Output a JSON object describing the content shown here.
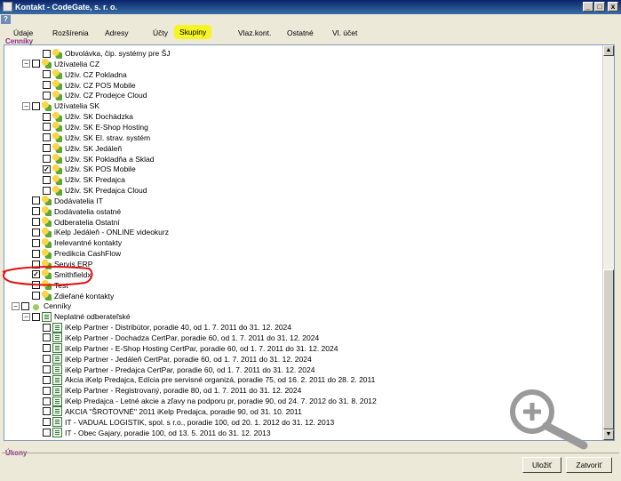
{
  "window": {
    "title": "Kontakt - CodeGate, s. r. o.",
    "help_label": "?",
    "minimize_label": "_",
    "maximize_label": "□",
    "close_label": "x"
  },
  "tabs": [
    {
      "label": "Údaje",
      "active": false
    },
    {
      "label": "Rozšírenia",
      "active": false
    },
    {
      "label": "Adresy",
      "active": false
    },
    {
      "label": "Účty",
      "active": false
    },
    {
      "label": "Skupiny",
      "active": true
    },
    {
      "label": "Vlaz.kont.",
      "active": false
    },
    {
      "label": "Ostatné",
      "active": false
    },
    {
      "label": "Vl. účet",
      "active": false
    }
  ],
  "section_top": "Cenníky",
  "section_bottom": "Úkony",
  "tree": [
    {
      "label": "Obvolávka, čip. systémy pre ŠJ",
      "checked": false,
      "icon": "group-icon"
    },
    {
      "label": "Užívatelia CZ",
      "checked": false,
      "icon": "group-icon"
    },
    {
      "label": "Uživ. CZ Pokladna",
      "checked": false,
      "icon": "group-icon"
    },
    {
      "label": "Uživ. CZ POS Mobile",
      "checked": false,
      "icon": "group-icon"
    },
    {
      "label": "Uživ. CZ Prodejce Cloud",
      "checked": false,
      "icon": "group-icon"
    },
    {
      "label": "Užívatelia SK",
      "checked": false,
      "icon": "group-icon"
    },
    {
      "label": "Uživ. SK Dochádzka",
      "checked": false,
      "icon": "group-icon"
    },
    {
      "label": "Uživ. SK E-Shop Hosting",
      "checked": false,
      "icon": "group-icon"
    },
    {
      "label": "Uživ. SK El. strav. systém",
      "checked": false,
      "icon": "group-icon"
    },
    {
      "label": "Uživ. SK Jedáleň",
      "checked": false,
      "icon": "group-icon"
    },
    {
      "label": "Uživ. SK Pokladňa a Sklad",
      "checked": false,
      "icon": "group-icon"
    },
    {
      "label": "Uživ. SK POS Mobile",
      "checked": true,
      "icon": "group-icon"
    },
    {
      "label": "Uživ. SK Predajca",
      "checked": false,
      "icon": "group-icon"
    },
    {
      "label": "Uživ. SK Predajca Cloud",
      "checked": false,
      "icon": "group-icon"
    },
    {
      "label": "Dodávatelia IT",
      "checked": false,
      "icon": "group-icon"
    },
    {
      "label": "Dodávatelia ostatné",
      "checked": false,
      "icon": "group-icon"
    },
    {
      "label": "Odberatelia Ostatní",
      "checked": false,
      "icon": "group-icon"
    },
    {
      "label": "iKelp Jedáleň - ONLINE videokurz",
      "checked": false,
      "icon": "group-icon"
    },
    {
      "label": "Irelevantné kontakty",
      "checked": false,
      "icon": "group-icon"
    },
    {
      "label": "Predikcia CashFlow",
      "checked": false,
      "icon": "group-icon"
    },
    {
      "label": "Servis ERP",
      "checked": false,
      "icon": "group-icon"
    },
    {
      "label": "Smithfieldx",
      "checked": true,
      "icon": "group-icon"
    },
    {
      "label": "Test",
      "checked": false,
      "icon": "group-icon"
    },
    {
      "label": "Zdieľané kontakty",
      "checked": false,
      "icon": "group-icon"
    },
    {
      "label": "Cenníky",
      "checked": false,
      "icon": "pricelist-icon"
    },
    {
      "label": "Neplatné odberateľské",
      "checked": false,
      "icon": "document-icon"
    },
    {
      "label": "iKelp Partner - Distribútor, poradie 40, od 1. 7. 2011 do 31. 12. 2024",
      "checked": false,
      "icon": "document-icon"
    },
    {
      "label": "iKelp Partner - Dochadza CertPar, poradie 60, od 1. 7. 2011 do 31. 12. 2024",
      "checked": false,
      "icon": "document-icon"
    },
    {
      "label": "iKelp Partner - E-Shop Hosting CertPar, poradie 60, od 1. 7. 2011 do 31. 12. 2024",
      "checked": false,
      "icon": "document-icon"
    },
    {
      "label": "iKelp Partner - Jedáleň CertPar, poradie 60, od 1. 7. 2011 do 31. 12. 2024",
      "checked": false,
      "icon": "document-icon"
    },
    {
      "label": "iKelp Partner - Predajca CertPar, poradie 60, od 1. 7. 2011 do 31. 12. 2024",
      "checked": false,
      "icon": "document-icon"
    },
    {
      "label": "Akcia iKelp Predajca, Edícia pre servisné organizá, poradie 75, od 16. 2. 2011 do 28. 2. 2011",
      "checked": false,
      "icon": "document-icon"
    },
    {
      "label": "iKelp Partner - Registrovaný, poradie 80, od 1. 7. 2011 do 31. 12. 2024",
      "checked": false,
      "icon": "document-icon"
    },
    {
      "label": "iKelp Predajca - Letné akcie a zľavy na podporu pr, poradie 90, od 24. 7. 2012 do 31. 8. 2012",
      "checked": false,
      "icon": "document-icon"
    },
    {
      "label": "AKCIA \"ŠROTOVNÉ\" 2011 iKelp Predajca, poradie 90, od 31. 10. 2011",
      "checked": false,
      "icon": "document-icon"
    },
    {
      "label": "IT - VADUAL LOGISTIK, spol. s r.o., poradie 100, od 20. 1. 2012 do 31. 12. 2013",
      "checked": false,
      "icon": "document-icon"
    },
    {
      "label": "IT - Obec Gajary, poradie 100, od 13. 5. 2011 do 31. 12. 2013",
      "checked": false,
      "icon": "document-icon"
    }
  ],
  "buttons": {
    "save": "Uložiť",
    "close": "Zatvoriť"
  },
  "colors": {
    "active_tab_highlight": "#f5f523",
    "annotation": "#e01010",
    "title_bar": "#0a246a"
  }
}
